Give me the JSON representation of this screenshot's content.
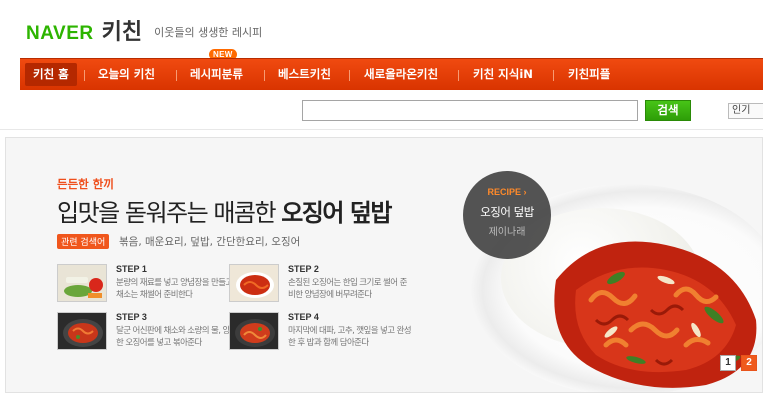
{
  "header": {
    "brand": "NAVER",
    "section": "키친",
    "tagline": "이웃들의 생생한 레시피"
  },
  "nav": {
    "items": [
      {
        "label": "키친 홈"
      },
      {
        "label": "오늘의 키친"
      },
      {
        "label": "레시피분류",
        "badge": "NEW"
      },
      {
        "label": "베스트키친"
      },
      {
        "label": "새로올라온키친"
      },
      {
        "label": "키친 지식iN"
      },
      {
        "label": "키친피플"
      }
    ],
    "color": "#e83c0a"
  },
  "search": {
    "value": "",
    "button_label": "검색",
    "side_tab": "인기"
  },
  "banner": {
    "label": "든든한 한끼",
    "headline_prefix": "입맛을 돋워주는 매콤한 ",
    "headline_bold": "오징어 덮밥",
    "related_badge": "관련 검색어",
    "related_keywords": "볶음, 매운요리, 덮밥, 간단한요리, 오징어",
    "steps": [
      {
        "title": "STEP 1",
        "desc": "분량의 재료를 넣고 양념장을 만들고, 채소는 채썰어 준비한다"
      },
      {
        "title": "STEP 2",
        "desc": "손질된 오징어는 한입 크기로 썰어 준비한 양념장에 버무려준다"
      },
      {
        "title": "STEP 3",
        "desc": "달군 어신판에 채소와 소량의 물, 양념한 오징어를 넣고 볶아준다"
      },
      {
        "title": "STEP 4",
        "desc": "마지막에 대파, 고추, 깻잎을 넣고 완성한 후 밥과 함께 담아준다"
      }
    ],
    "recipe_tag": "RECIPE ›",
    "recipe_dish": "오징어 덮밥",
    "recipe_author": "제이나래",
    "pages": [
      "1",
      "2"
    ],
    "current_page": "2"
  }
}
